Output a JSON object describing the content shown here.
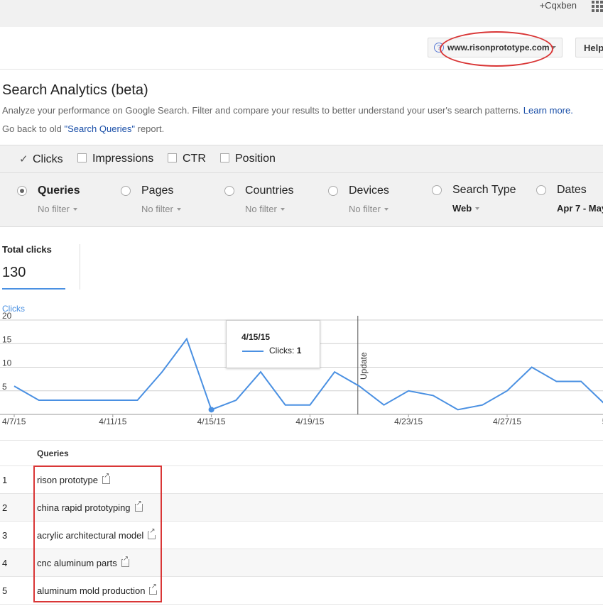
{
  "header": {
    "user": "+Cqxben",
    "site": "www.risonprototype.com",
    "help": "Help"
  },
  "page": {
    "title": "Search Analytics (beta)",
    "description": "Analyze your performance on Google Search. Filter and compare your results to better understand your user's search patterns.",
    "learn_more": "Learn more.",
    "back_prefix": "Go back to old ",
    "back_link": "\"Search Queries\"",
    "back_suffix": " report."
  },
  "metrics": [
    {
      "label": "Clicks",
      "checked": true
    },
    {
      "label": "Impressions",
      "checked": false
    },
    {
      "label": "CTR",
      "checked": false
    },
    {
      "label": "Position",
      "checked": false
    }
  ],
  "dimensions": [
    {
      "label": "Queries",
      "filter": "No filter",
      "selected": true
    },
    {
      "label": "Pages",
      "filter": "No filter",
      "selected": false
    },
    {
      "label": "Countries",
      "filter": "No filter",
      "selected": false
    },
    {
      "label": "Devices",
      "filter": "No filter",
      "selected": false
    },
    {
      "label": "Search Type",
      "filter": "Web",
      "selected": false
    },
    {
      "label": "Dates",
      "filter": "Apr 7 - May",
      "selected": false
    }
  ],
  "totals": {
    "label": "Total clicks",
    "value": "130"
  },
  "chart_data": {
    "type": "line",
    "series_label": "Clicks",
    "y_ticks": [
      "20",
      "15",
      "10",
      "5"
    ],
    "ylim": [
      0,
      20
    ],
    "x_tick_labels": [
      "4/7/15",
      "4/11/15",
      "4/15/15",
      "4/19/15",
      "4/23/15",
      "4/27/15",
      "5/"
    ],
    "series": [
      {
        "name": "Clicks",
        "x": [
          "4/7/15",
          "4/8/15",
          "4/9/15",
          "4/10/15",
          "4/11/15",
          "4/12/15",
          "4/13/15",
          "4/14/15",
          "4/15/15",
          "4/16/15",
          "4/17/15",
          "4/18/15",
          "4/19/15",
          "4/20/15",
          "4/21/15",
          "4/22/15",
          "4/23/15",
          "4/24/15",
          "4/25/15",
          "4/26/15",
          "4/27/15",
          "4/28/15",
          "4/29/15",
          "4/30/15",
          "5/1/15"
        ],
        "values": [
          6,
          3,
          3,
          3,
          3,
          3,
          9,
          16,
          1,
          3,
          9,
          2,
          2,
          9,
          6,
          2,
          5,
          4,
          1,
          2,
          5,
          10,
          7,
          7,
          2
        ]
      }
    ],
    "annotation": "Update",
    "tooltip": {
      "date": "4/15/15",
      "label": "Clicks:",
      "value": "1"
    },
    "color": "#4a90e2",
    "grid": true
  },
  "table": {
    "header": "Queries",
    "rows": [
      {
        "num": "1",
        "query": "rison prototype"
      },
      {
        "num": "2",
        "query": "china rapid prototyping"
      },
      {
        "num": "3",
        "query": "acrylic architectural model"
      },
      {
        "num": "4",
        "query": "cnc aluminum parts"
      },
      {
        "num": "5",
        "query": "aluminum mold production"
      }
    ]
  },
  "colors": {
    "accent": "#4a90e2",
    "link": "#1a4fa8",
    "annotation": "#d93636"
  },
  "icons": {
    "apps": "apps-grid-icon",
    "check": "checkmark-icon",
    "external": "external-link-icon"
  }
}
